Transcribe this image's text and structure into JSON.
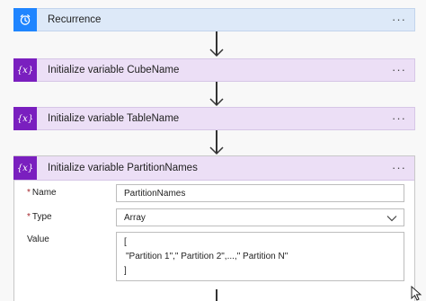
{
  "flow": {
    "recurrence": {
      "title": "Recurrence",
      "icon": "alarm-clock-icon",
      "more": "···"
    },
    "steps": [
      {
        "title": "Initialize variable CubeName",
        "icon": "variable-icon",
        "glyph": "{x}",
        "more": "···"
      },
      {
        "title": "Initialize variable TableName",
        "icon": "variable-icon",
        "glyph": "{x}",
        "more": "···"
      }
    ],
    "expanded": {
      "title": "Initialize variable PartitionNames",
      "glyph": "{x}",
      "more": "···",
      "fields": {
        "name": {
          "label": "Name",
          "required": "*",
          "value": "PartitionNames"
        },
        "type": {
          "label": "Type",
          "required": "*",
          "value": "Array"
        },
        "value": {
          "label": "Value",
          "lines": [
            "[",
            "\"Partition 1\",\" Partition 2\",...,\" Partition N\"",
            "]"
          ]
        }
      }
    }
  },
  "colors": {
    "recurrence_bg": "#dde9f8",
    "recurrence_icon": "#1f85ff",
    "variable_bg": "#ecdff6",
    "variable_icon": "#7a1fbf"
  }
}
